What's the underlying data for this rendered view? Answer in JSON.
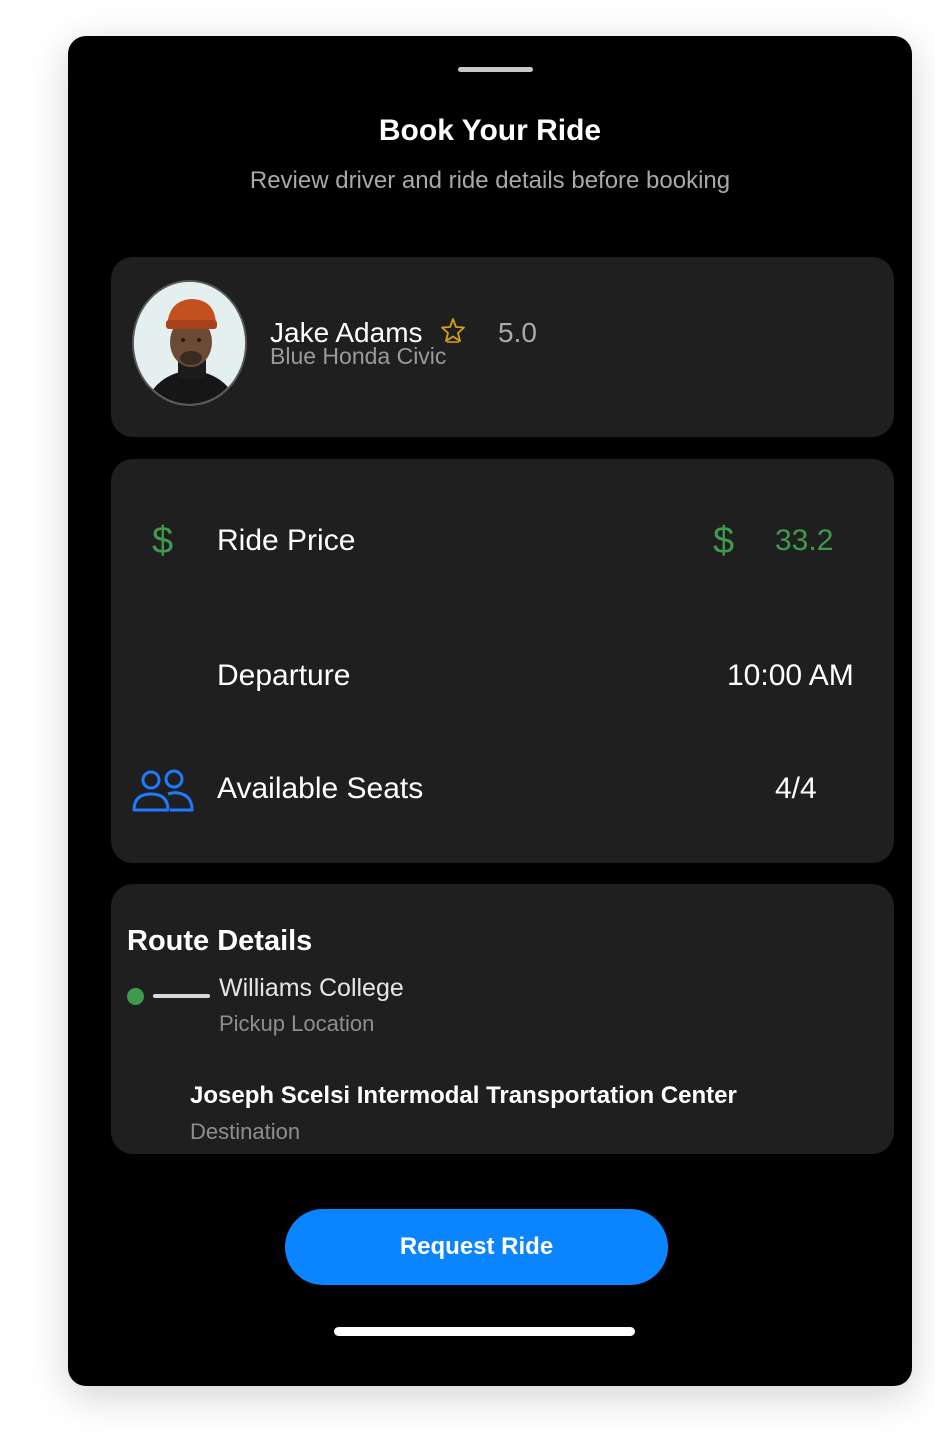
{
  "header": {
    "title": "Book Your Ride",
    "subtitle": "Review driver and ride details before booking"
  },
  "driver": {
    "name": "Jake Adams",
    "rating": "5.0",
    "car": "Blue Honda Civic",
    "rating_icon": "star-icon",
    "avatar": "driver-photo"
  },
  "ride": {
    "price_label": "Ride Price",
    "price_currency": "$",
    "price_value": "33.2",
    "departure_label": "Departure",
    "departure_value": "10:00 AM",
    "seats_label": "Available Seats",
    "seats_value": "4/4",
    "price_icon": "dollar-icon",
    "seats_icon": "users-icon"
  },
  "route": {
    "title": "Route Details",
    "pickup_name": "Williams College",
    "pickup_label": "Pickup Location",
    "destination_name": "Joseph Scelsi Intermodal Transportation Center",
    "destination_label": "Destination"
  },
  "actions": {
    "request_label": "Request Ride"
  },
  "colors": {
    "background": "#000000",
    "card": "#1f1f1f",
    "accent": "#0a84ff",
    "price": "#3f9a4d",
    "star": "#d4a017"
  }
}
